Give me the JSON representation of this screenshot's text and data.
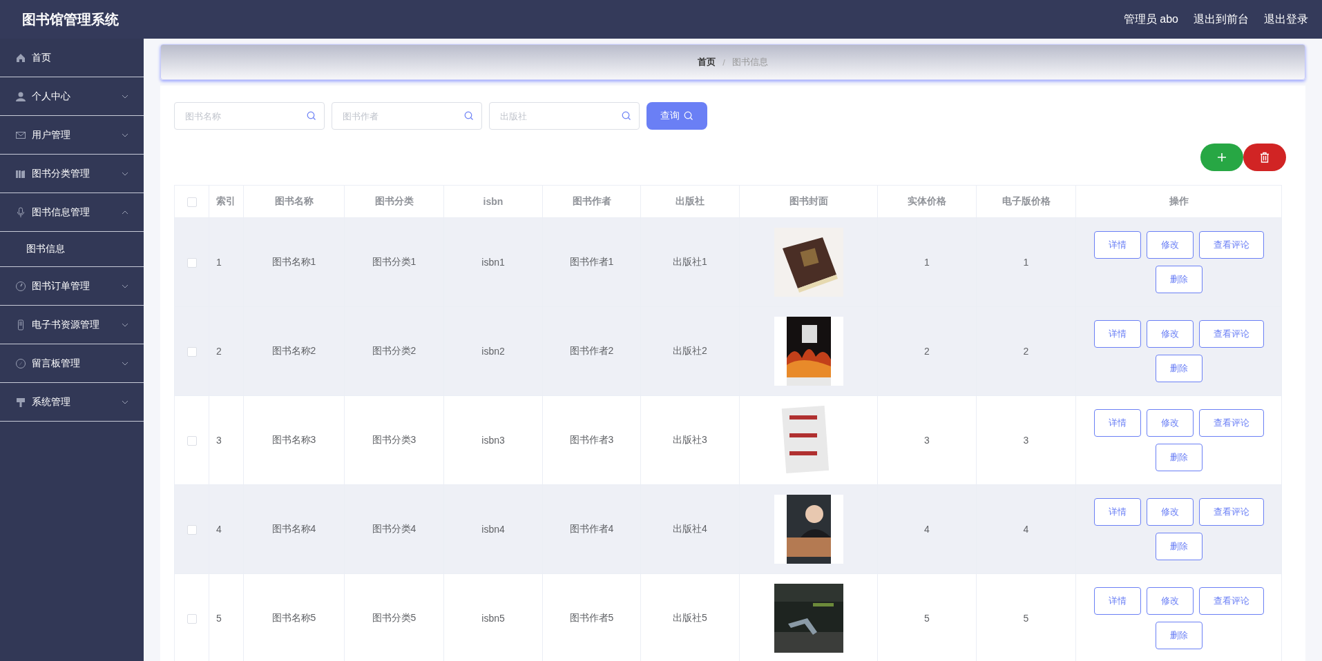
{
  "header": {
    "title": "图书馆管理系统",
    "links": [
      "管理员 abo",
      "退出到前台",
      "退出登录"
    ]
  },
  "sidebar": {
    "items": [
      {
        "label": "首页",
        "expandable": false
      },
      {
        "label": "个人中心",
        "expandable": true,
        "expanded": false
      },
      {
        "label": "用户管理",
        "expandable": true,
        "expanded": false
      },
      {
        "label": "图书分类管理",
        "expandable": true,
        "expanded": false
      },
      {
        "label": "图书信息管理",
        "expandable": true,
        "expanded": true,
        "children": [
          {
            "label": "图书信息"
          }
        ]
      },
      {
        "label": "图书订单管理",
        "expandable": true,
        "expanded": false
      },
      {
        "label": "电子书资源管理",
        "expandable": true,
        "expanded": false
      },
      {
        "label": "留言板管理",
        "expandable": true,
        "expanded": false
      },
      {
        "label": "系统管理",
        "expandable": true,
        "expanded": false
      }
    ]
  },
  "breadcrumb": {
    "items": [
      "首页",
      "图书信息"
    ],
    "separator": "/"
  },
  "search": {
    "fields": [
      {
        "placeholder": "图书名称"
      },
      {
        "placeholder": "图书作者"
      },
      {
        "placeholder": "出版社"
      }
    ],
    "button": "查询"
  },
  "table": {
    "header_checked": false,
    "columns": [
      "索引",
      "图书名称",
      "图书分类",
      "isbn",
      "图书作者",
      "出版社",
      "图书封面",
      "实体价格",
      "电子版价格",
      "操作"
    ],
    "rows": [
      {
        "checked": false,
        "highlighted": true,
        "cells": [
          "1",
          "图书名称1",
          "图书分类1",
          "isbn1",
          "图书作者1",
          "出版社1",
          {
            "kind": "picture"
          },
          "1",
          "1"
        ],
        "actions": [
          "详情",
          "修改",
          "查看评论",
          "删除"
        ]
      },
      {
        "checked": false,
        "highlighted": true,
        "cells": [
          "2",
          "图书名称2",
          "图书分类2",
          "isbn2",
          "图书作者2",
          "出版社2",
          {
            "kind": "picture"
          },
          "2",
          "2"
        ],
        "actions": [
          "详情",
          "修改",
          "查看评论",
          "删除"
        ]
      },
      {
        "checked": false,
        "highlighted": false,
        "cells": [
          "3",
          "图书名称3",
          "图书分类3",
          "isbn3",
          "图书作者3",
          "出版社3",
          {
            "kind": "picture"
          },
          "3",
          "3"
        ],
        "actions": [
          "详情",
          "修改",
          "查看评论",
          "删除"
        ]
      },
      {
        "checked": false,
        "highlighted": true,
        "cells": [
          "4",
          "图书名称4",
          "图书分类4",
          "isbn4",
          "图书作者4",
          "出版社4",
          {
            "kind": "picture"
          },
          "4",
          "4"
        ],
        "actions": [
          "详情",
          "修改",
          "查看评论",
          "删除"
        ]
      },
      {
        "checked": false,
        "highlighted": false,
        "cells": [
          "5",
          "图书名称5",
          "图书分类5",
          "isbn5",
          "图书作者5",
          "出版社5",
          {
            "kind": "picture"
          },
          "5",
          "5"
        ],
        "actions": [
          "详情",
          "修改",
          "查看评论",
          "删除"
        ]
      }
    ]
  }
}
